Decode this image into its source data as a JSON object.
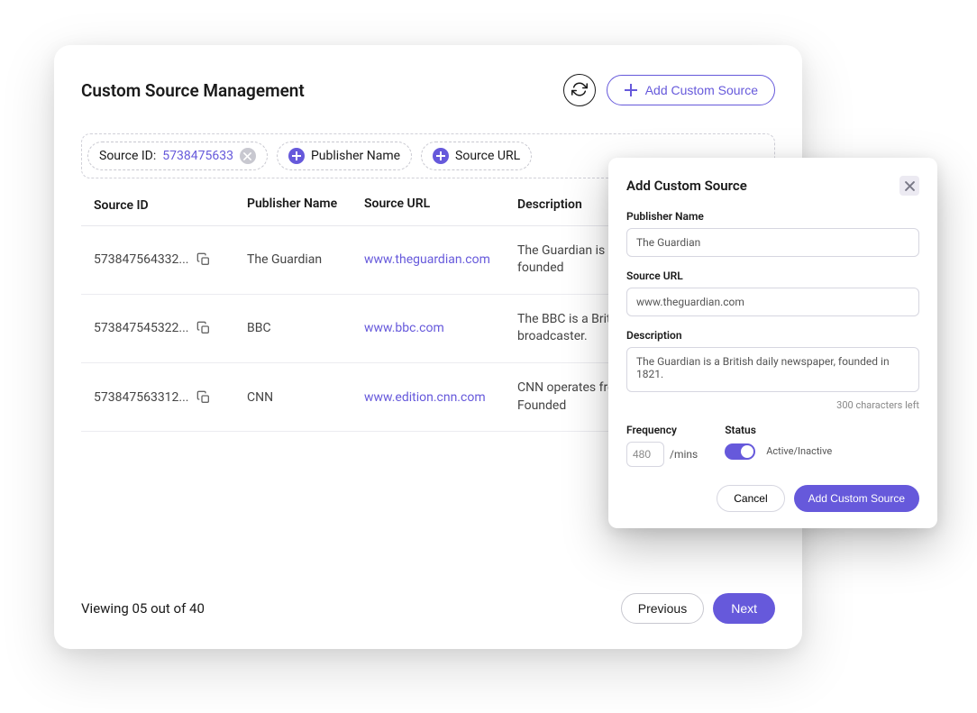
{
  "colors": {
    "primary": "#6659db"
  },
  "header": {
    "title": "Custom Source Management",
    "refresh_icon": "refresh",
    "add_button_label": "Add Custom Source"
  },
  "filters": {
    "source_id": {
      "label": "Source ID:",
      "value": "5738475633"
    },
    "publisher": {
      "label": "Publisher Name"
    },
    "source_url": {
      "label": "Source URL"
    }
  },
  "table": {
    "columns": {
      "id": "Source ID",
      "publisher": "Publisher Name",
      "url": "Source URL",
      "desc": "Description"
    },
    "rows": [
      {
        "id": "573847564332...",
        "publisher": "The Guardian",
        "url": "www.theguardian.com",
        "desc": "The Guardian is a British daily newspaper, founded"
      },
      {
        "id": "573847545322...",
        "publisher": "BBC",
        "url": "www.bbc.com",
        "desc": "The BBC is a British public service broadcaster."
      },
      {
        "id": "573847563312...",
        "publisher": "CNN",
        "url": "www.edition.cnn.com",
        "desc": "CNN operates from New York, Atlanta, U.S. Founded"
      }
    ]
  },
  "footer": {
    "viewing": "Viewing 05 out of 40",
    "previous": "Previous",
    "next": "Next"
  },
  "modal": {
    "title": "Add Custom Source",
    "publisher": {
      "label": "Publisher Name",
      "value": "The Guardian"
    },
    "url": {
      "label": "Source URL",
      "value": "www.theguardian.com"
    },
    "description": {
      "label": "Description",
      "value": "The Guardian is a British daily newspaper, founded in 1821.",
      "chars_left": "300 characters left"
    },
    "frequency": {
      "label": "Frequency",
      "value": "480",
      "unit": "/mins"
    },
    "status": {
      "label": "Status",
      "toggle_label": "Active/Inactive",
      "active": true
    },
    "cancel": "Cancel",
    "submit": "Add Custom Source"
  }
}
